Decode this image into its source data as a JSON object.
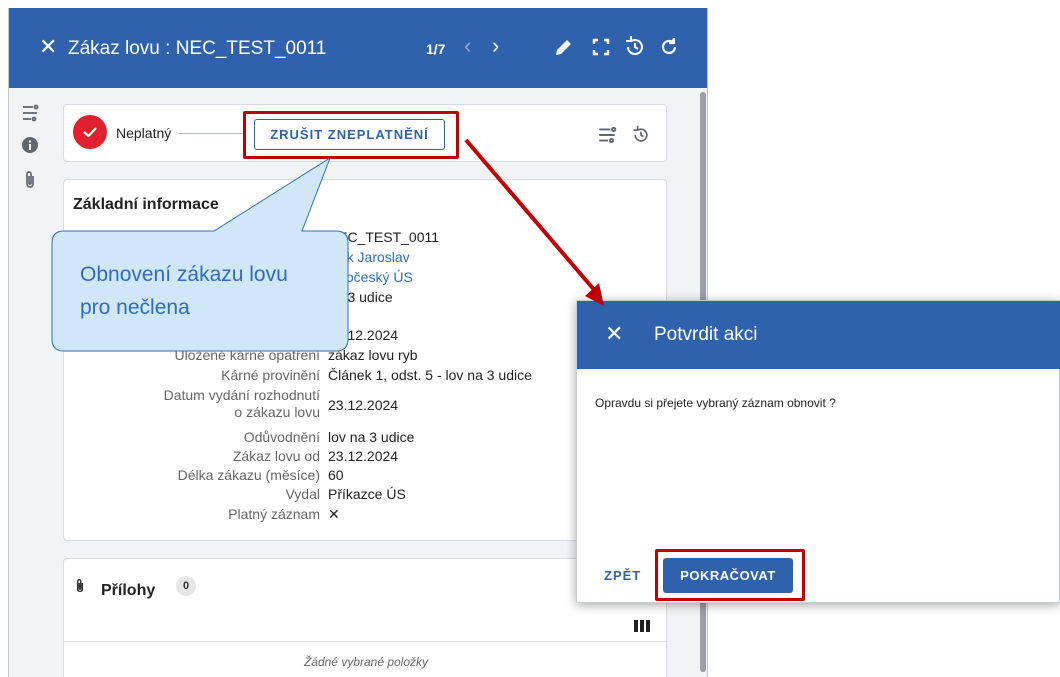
{
  "header": {
    "title": "Zákaz lovu : NEC_TEST_0011",
    "pager": "1/7",
    "prev_icon": "chevron-left-icon",
    "next_icon": "chevron-right-icon",
    "tool_icons": [
      "edit-icon",
      "fullscreen-icon",
      "history-icon",
      "refresh-icon"
    ]
  },
  "rail": {
    "icons": [
      "workflow-icon",
      "info-icon",
      "paperclip-icon"
    ]
  },
  "status": {
    "label": "Neplatný",
    "button": "ZRUŠIT ZNEPLATNĚNÍ"
  },
  "info": {
    "title": "Základní informace",
    "rows": [
      {
        "label": "",
        "value": "NEC_TEST_0011"
      },
      {
        "label": "",
        "value": "Mlík Jaroslav"
      },
      {
        "label": "",
        "value": "Jihočeský ÚS"
      },
      {
        "label": "",
        "value": "na 3 udice"
      },
      {
        "label": "",
        "value": "23.12.2024"
      },
      {
        "label": "Uložené kárné opatření",
        "value": "zákaz lovu ryb"
      },
      {
        "label": "Kárné provinění",
        "value": "Článek 1, odst. 5 - lov na 3 udice"
      },
      {
        "label": "Datum vydání rozhodnutí o zákazu lovu",
        "value": "23.12.2024"
      },
      {
        "label": "Odůvodnění",
        "value": "lov na 3 udice"
      },
      {
        "label": "Zákaz lovu od",
        "value": "23.12.2024"
      },
      {
        "label": "Délka zákazu (měsíce)",
        "value": "60"
      },
      {
        "label": "Vydal",
        "value": "Příkazce ÚS"
      },
      {
        "label": "Platný záznam",
        "value": "✕"
      }
    ]
  },
  "attachments": {
    "title": "Přílohy",
    "count": "0",
    "empty": "Žádné vybrané položky"
  },
  "dialog": {
    "title": "Potvrdit akci",
    "message": "Opravdu si přejete vybraný záznam obnovit ?",
    "back": "ZPĚT",
    "continue": "POKRAČOVAT"
  },
  "callout": {
    "line1": "Obnovení zákazu lovu",
    "line2": "pro nečlena"
  },
  "colors": {
    "primary": "#2f62ac",
    "danger": "#e0202c",
    "highlight": "#c00000",
    "callout_fill": "#cfe7f7",
    "callout_text": "#2f6cbf"
  }
}
